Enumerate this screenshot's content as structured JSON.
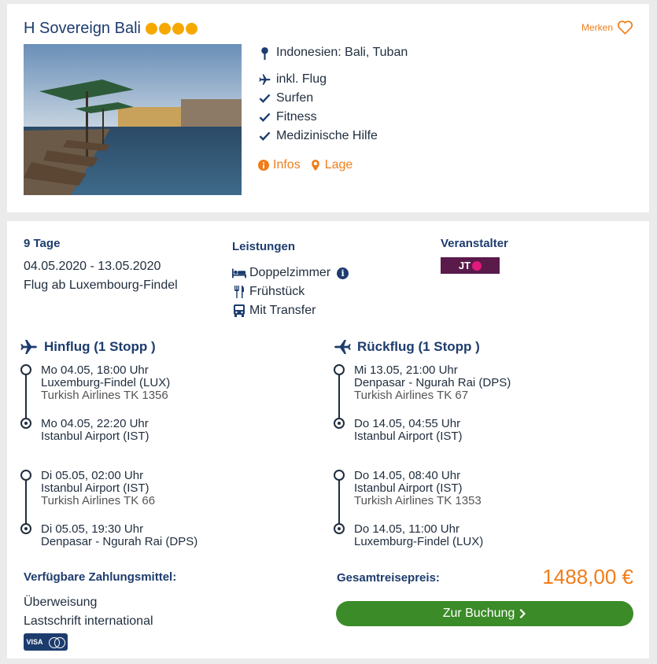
{
  "hotel": {
    "name": "H Sovereign Bali",
    "stars": 4,
    "merken_label": "Merken",
    "location": "Indonesien: Bali, Tuban",
    "features": [
      "inkl. Flug",
      "Surfen",
      "Fitness",
      "Medizinische Hilfe"
    ],
    "links": {
      "infos": "Infos",
      "lage": "Lage"
    }
  },
  "trip": {
    "duration": "9 Tage",
    "dates": "04.05.2020 - 13.05.2020",
    "departure": "Flug ab Luxembourg-Findel",
    "leistungen_heading": "Leistungen",
    "leistungen": [
      "Doppelzimmer",
      "Frühstück",
      "Mit Transfer"
    ],
    "veranstalter_heading": "Veranstalter",
    "veranstalter_logo_text": "JT"
  },
  "hinflug": {
    "heading": "Hinflug (1 Stopp )",
    "legs": [
      {
        "dep_time": "Mo 04.05, 18:00 Uhr",
        "dep_airport": "Luxemburg-Findel (LUX)",
        "airline": "Turkish Airlines TK 1356",
        "arr_time": "Mo 04.05, 22:20 Uhr",
        "arr_airport": "Istanbul Airport (IST)"
      },
      {
        "dep_time": "Di 05.05, 02:00 Uhr",
        "dep_airport": "Istanbul Airport (IST)",
        "airline": "Turkish Airlines TK 66",
        "arr_time": "Di 05.05, 19:30 Uhr",
        "arr_airport": "Denpasar - Ngurah Rai (DPS)"
      }
    ]
  },
  "rueckflug": {
    "heading": "Rückflug (1 Stopp )",
    "legs": [
      {
        "dep_time": "Mi 13.05, 21:00 Uhr",
        "dep_airport": "Denpasar - Ngurah Rai (DPS)",
        "airline": "Turkish Airlines TK 67",
        "arr_time": "Do 14.05, 04:55 Uhr",
        "arr_airport": "Istanbul Airport (IST)"
      },
      {
        "dep_time": "Do 14.05, 08:40 Uhr",
        "dep_airport": "Istanbul Airport (IST)",
        "airline": "Turkish Airlines TK 1353",
        "arr_time": "Do 14.05, 11:00 Uhr",
        "arr_airport": "Luxemburg-Findel (LUX)"
      }
    ]
  },
  "payment": {
    "heading": "Verfügbare Zahlungsmittel:",
    "methods": [
      "Überweisung",
      "Lastschrift international"
    ],
    "visa_label": "VISA"
  },
  "price": {
    "label": "Gesamtreisepreis:",
    "value": "1488,00 €",
    "button": "Zur Buchung"
  },
  "colors": {
    "accent": "#f07d1a",
    "navy": "#1d3c6e",
    "button": "#3b8b28",
    "stars": "#f5a800"
  }
}
